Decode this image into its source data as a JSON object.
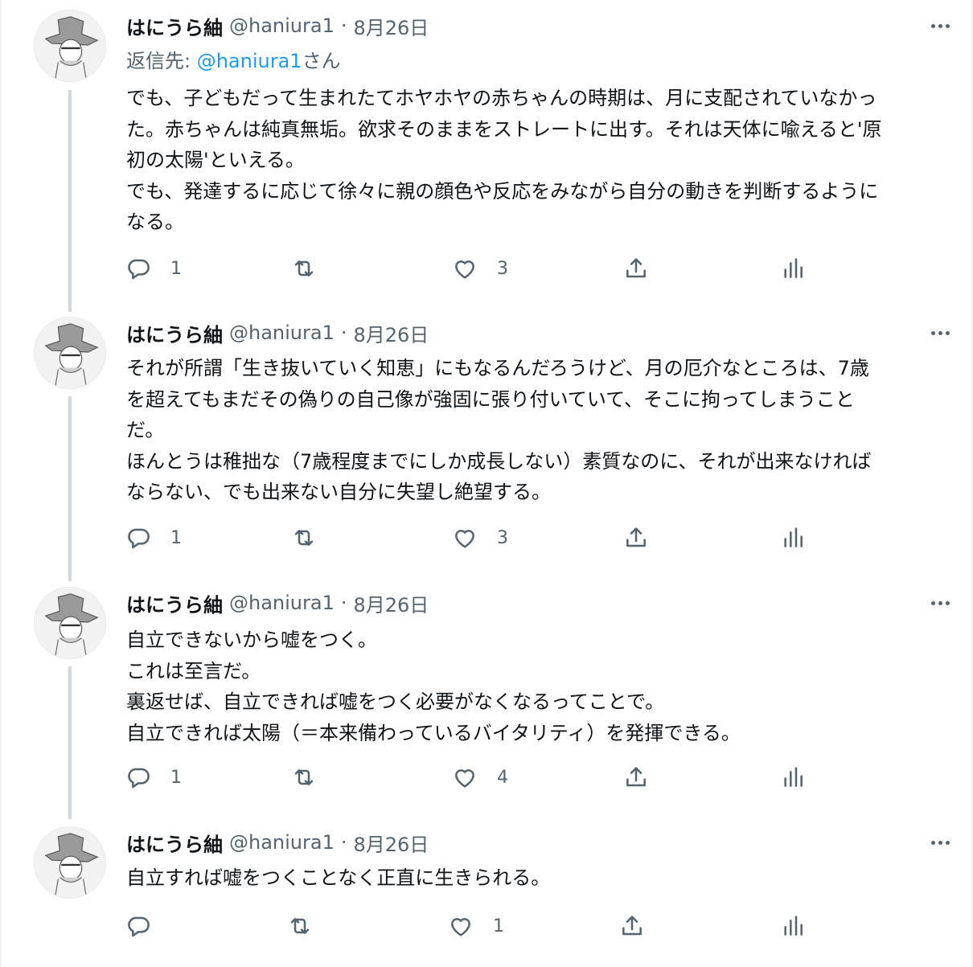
{
  "author": {
    "name": "はにうら紬",
    "handle": "@haniura1",
    "dot": "·"
  },
  "icons": {
    "reply": "reply-icon",
    "retweet": "retweet-icon",
    "like": "heart-icon",
    "share": "share-icon",
    "analytics": "analytics-icon",
    "more": "more-icon"
  },
  "colors": {
    "link": "#1d9bf0",
    "secondary_text": "#536471",
    "thread_line": "#cfd9de"
  },
  "tweets": [
    {
      "date": "8月26日",
      "reply_to": {
        "prefix": "返信先: ",
        "handle": "@haniura1",
        "suffix": "さん"
      },
      "lines": [
        "でも、子どもだって生まれたてホヤホヤの赤ちゃんの時期は、月に支配されていなかっ",
        "た。赤ちゃんは純真無垢。欲求そのままをストレートに出す。それは天体に喩えると'原",
        "初の太陽'といえる。",
        "でも、発達するに応じて徐々に親の顔色や反応をみながら自分の動きを判断するように",
        "なる。"
      ],
      "replies": "1",
      "retweets": "",
      "likes": "3"
    },
    {
      "date": "8月26日",
      "lines": [
        "それが所謂「生き抜いていく知恵」にもなるんだろうけど、月の厄介なところは、7歳",
        "を超えてもまだその偽りの自己像が強固に張り付いていて、そこに拘ってしまうこと",
        "だ。",
        "ほんとうは稚拙な（7歳程度までにしか成長しない）素質なのに、それが出来なければ",
        "ならない、でも出来ない自分に失望し絶望する。"
      ],
      "replies": "1",
      "retweets": "",
      "likes": "3"
    },
    {
      "date": "8月26日",
      "lines": [
        "自立できないから嘘をつく。",
        "これは至言だ。",
        "裏返せば、自立できれば嘘をつく必要がなくなるってことで。",
        "自立できれば太陽（＝本来備わっているバイタリティ）を発揮できる。"
      ],
      "replies": "1",
      "retweets": "",
      "likes": "4"
    },
    {
      "date": "8月26日",
      "lines": [
        "自立すれば嘘をつくことなく正直に生きられる。"
      ],
      "replies": "",
      "retweets": "",
      "likes": "1"
    }
  ]
}
